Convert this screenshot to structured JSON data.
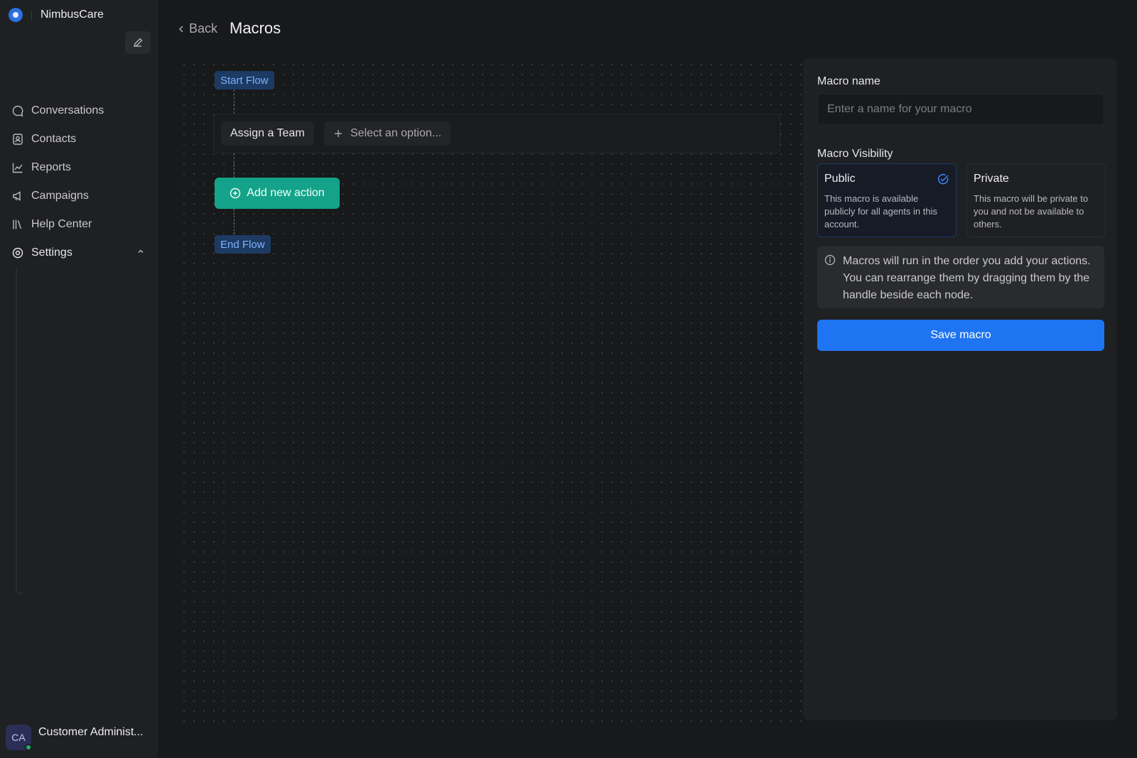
{
  "app": {
    "name": "NimbusCare"
  },
  "sidebar": {
    "items": [
      {
        "label": "Conversations",
        "icon": "chat-bubble-icon"
      },
      {
        "label": "Contacts",
        "icon": "contact-card-icon"
      },
      {
        "label": "Reports",
        "icon": "line-chart-icon"
      },
      {
        "label": "Campaigns",
        "icon": "megaphone-icon"
      },
      {
        "label": "Help Center",
        "icon": "library-icon"
      },
      {
        "label": "Settings",
        "icon": "gear-icon"
      }
    ],
    "profile": {
      "initials": "CA",
      "name": "Customer Administ...",
      "status_color": "#20b26b"
    }
  },
  "header": {
    "back_label": "Back",
    "title": "Macros"
  },
  "flow": {
    "start_label": "Start Flow",
    "end_label": "End Flow",
    "action": {
      "label": "Assign a Team",
      "select_placeholder": "Select an option..."
    },
    "add_action_label": "Add new action"
  },
  "panel": {
    "name_label": "Macro name",
    "name_placeholder": "Enter a name for your macro",
    "name_value": "",
    "visibility_label": "Macro Visibility",
    "visibility_options": [
      {
        "title": "Public",
        "description": "This macro is available publicly for all agents in this account.",
        "selected": true
      },
      {
        "title": "Private",
        "description": "This macro will be private to you and not be available to others.",
        "selected": false
      }
    ],
    "info_text": "Macros will run in the order you add your actions. You can rearrange them by dragging them by the handle beside each node.",
    "save_label": "Save macro"
  },
  "colors": {
    "accent_blue": "#1f74f2",
    "accent_teal": "#14a38a",
    "flow_tag": "#1d3a63"
  }
}
